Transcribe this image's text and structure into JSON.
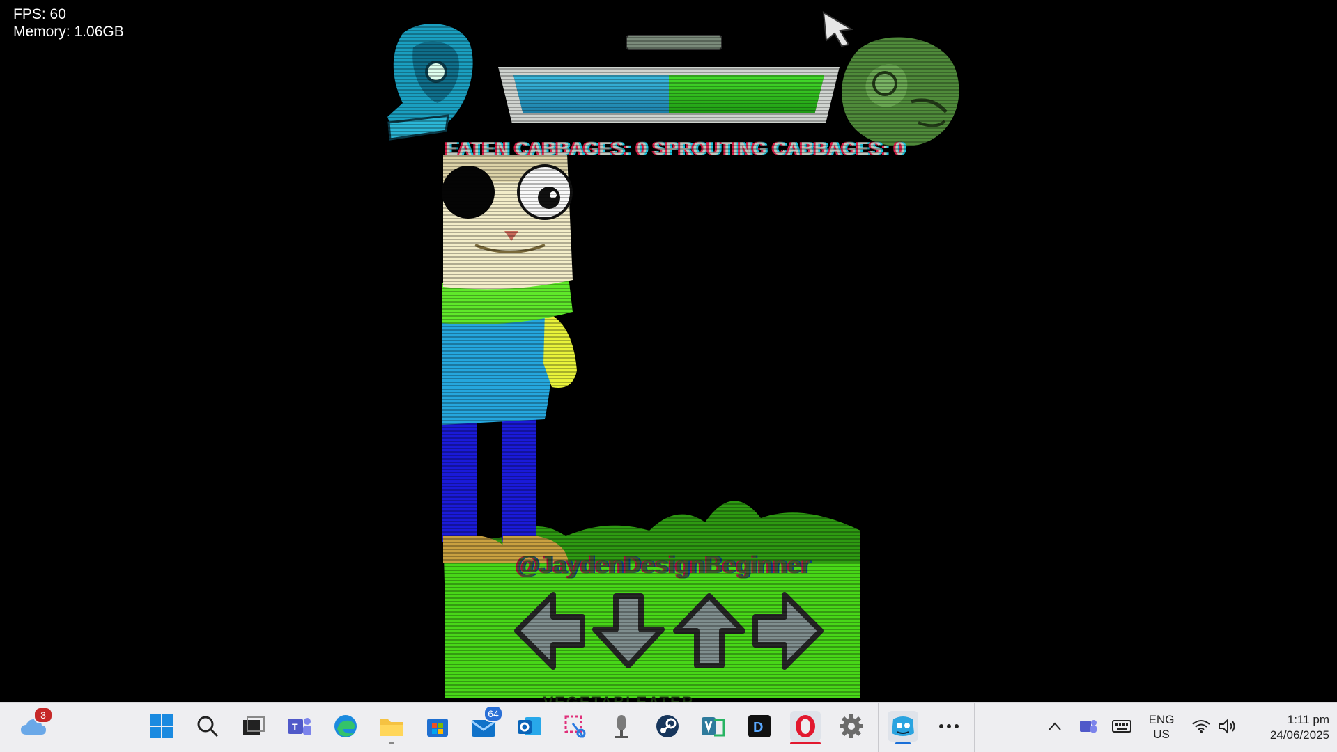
{
  "overlay": {
    "fps_label": "FPS: 60",
    "memory_label": "Memory: 1.06GB"
  },
  "hud": {
    "score_text": "EATEN CABBAGES: 0 SPROUTING CABBAGES: 0",
    "health_player_fraction": 0.5,
    "health_opponent_color": "#2fa6d4",
    "health_player_color": "#3ccf22",
    "opponent_icon": "blue-character-icon",
    "player_icon": "green-character-icon"
  },
  "stage": {
    "credit_text": "@JaydenDesignBeginner",
    "character": "cartoon-boy-green-collar-blue-shirt",
    "bottom_text": "VEGETABLEATER"
  },
  "strums": [
    {
      "direction": "left",
      "icon": "arrow-left-icon"
    },
    {
      "direction": "down",
      "icon": "arrow-down-icon"
    },
    {
      "direction": "up",
      "icon": "arrow-up-icon"
    },
    {
      "direction": "right",
      "icon": "arrow-right-icon"
    }
  ],
  "taskbar": {
    "weather_badge": "3",
    "outlook_badge": "64",
    "apps": [
      "weather-icon",
      "start-icon",
      "search-icon",
      "task-view-icon",
      "teams-icon",
      "edge-icon",
      "file-explorer-icon",
      "microsoft-store-icon",
      "mail-icon",
      "outlook-icon",
      "snipping-tool-icon",
      "voice-recorder-icon",
      "steam-icon",
      "visio-icon",
      "app-d-icon",
      "opera-icon",
      "settings-icon",
      "fnf-game-icon",
      "more-apps-icon"
    ],
    "tray": {
      "lang_line1": "ENG",
      "lang_line2": "US",
      "time": "1:11 pm",
      "date": "24/06/2025"
    }
  }
}
